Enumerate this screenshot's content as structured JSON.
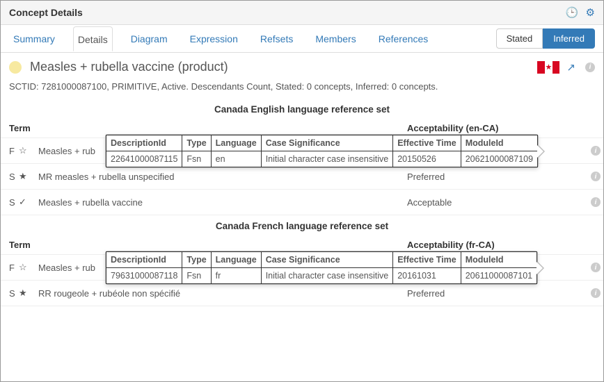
{
  "header": {
    "title": "Concept Details"
  },
  "tabs": [
    "Summary",
    "Details",
    "Diagram",
    "Expression",
    "Refsets",
    "Members",
    "References"
  ],
  "tabs_active": 1,
  "view_toggle": {
    "left": "Stated",
    "right": "Inferred"
  },
  "concept": {
    "title": "Measles + rubella vaccine (product)"
  },
  "metaline": "SCTID: 7281000087100, PRIMITIVE, Active. Descendants Count, Stated: 0 concepts, Inferred: 0 concepts.",
  "sections": {
    "en": {
      "title": "Canada English language reference set",
      "term_header": "Term",
      "acc_header": "Acceptability  (en-CA)",
      "rows": [
        {
          "marker": "F",
          "star": "outline",
          "term": "Measles + rub",
          "acc": ""
        },
        {
          "marker": "S",
          "star": "filled",
          "term": "MR measles + rubella unspecified",
          "acc": "Preferred"
        },
        {
          "marker": "S",
          "star": "check",
          "term": "Measles + rubella vaccine",
          "acc": "Acceptable"
        }
      ]
    },
    "fr": {
      "title": "Canada French language reference set",
      "term_header": "Term",
      "acc_header": "Acceptability  (fr-CA)",
      "rows": [
        {
          "marker": "F",
          "star": "outline",
          "term": "Measles + rub",
          "acc": ""
        },
        {
          "marker": "S",
          "star": "filled",
          "term": "RR rougeole + rubéole non spécifié",
          "acc": "Preferred"
        }
      ]
    }
  },
  "popover_headers": [
    "DescriptionId",
    "Type",
    "Language",
    "Case Significance",
    "Effective Time",
    "ModuleId"
  ],
  "popovers": {
    "en": {
      "cells": [
        "22641000087115",
        "Fsn",
        "en",
        "Initial character case insensitive",
        "20150526",
        "20621000087109"
      ]
    },
    "fr": {
      "cells": [
        "79631000087118",
        "Fsn",
        "fr",
        "Initial character case insensitive",
        "20161031",
        "20611000087101"
      ]
    }
  }
}
